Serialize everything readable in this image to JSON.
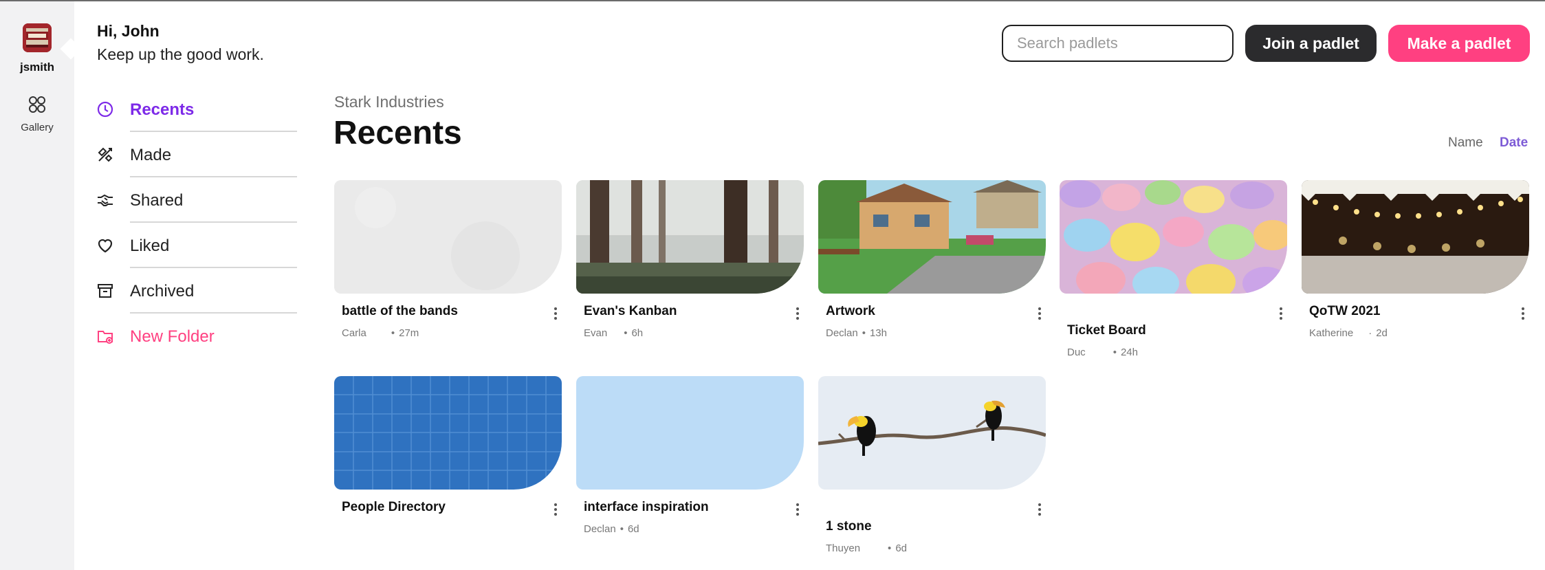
{
  "rail": {
    "username": "jsmith",
    "gallery_label": "Gallery"
  },
  "greeting": {
    "line1": "Hi, John",
    "line2": "Keep up the good work."
  },
  "nav": {
    "items": [
      {
        "label": "Recents",
        "icon": "clock-icon",
        "active": true
      },
      {
        "label": "Made",
        "icon": "tools-icon"
      },
      {
        "label": "Shared",
        "icon": "handshake-icon"
      },
      {
        "label": "Liked",
        "icon": "heart-icon"
      },
      {
        "label": "Archived",
        "icon": "archive-icon"
      },
      {
        "label": "New Folder",
        "icon": "new-folder-icon"
      }
    ]
  },
  "header": {
    "search_placeholder": "Search padlets",
    "join_label": "Join a padlet",
    "make_label": "Make a padlet"
  },
  "main": {
    "org": "Stark Industries",
    "title": "Recents",
    "sort_name": "Name",
    "sort_date": "Date"
  },
  "cards": [
    {
      "title": "battle of the bands",
      "author": "Carla",
      "time": "27m",
      "thumb": "paper-texture"
    },
    {
      "title": "Evan's Kanban",
      "author": "Evan",
      "time": "6h",
      "thumb": "redwood-forest"
    },
    {
      "title": "Artwork",
      "author": "Declan",
      "time": "13h",
      "thumb": "cartoon-house"
    },
    {
      "title": "Ticket Board",
      "author": "Duc",
      "time": "24h",
      "thumb": "candy-hearts"
    },
    {
      "title": "QoTW 2021",
      "author": "Katherine",
      "time": "2d",
      "thumb": "string-lights"
    },
    {
      "title": "People Directory",
      "author": "",
      "time": "",
      "thumb": "blue-grid"
    },
    {
      "title": "interface inspiration",
      "author": "Declan",
      "time": "6d",
      "thumb": "light-blue"
    },
    {
      "title": "1 stone",
      "author": "Thuyen",
      "time": "6d",
      "thumb": "toucans-branch"
    }
  ],
  "colors": {
    "accent_purple": "#7d2ae8",
    "brand_pink": "#ff4081",
    "dark_button": "#2b2b2d",
    "rail_bg": "#f2f2f3"
  }
}
